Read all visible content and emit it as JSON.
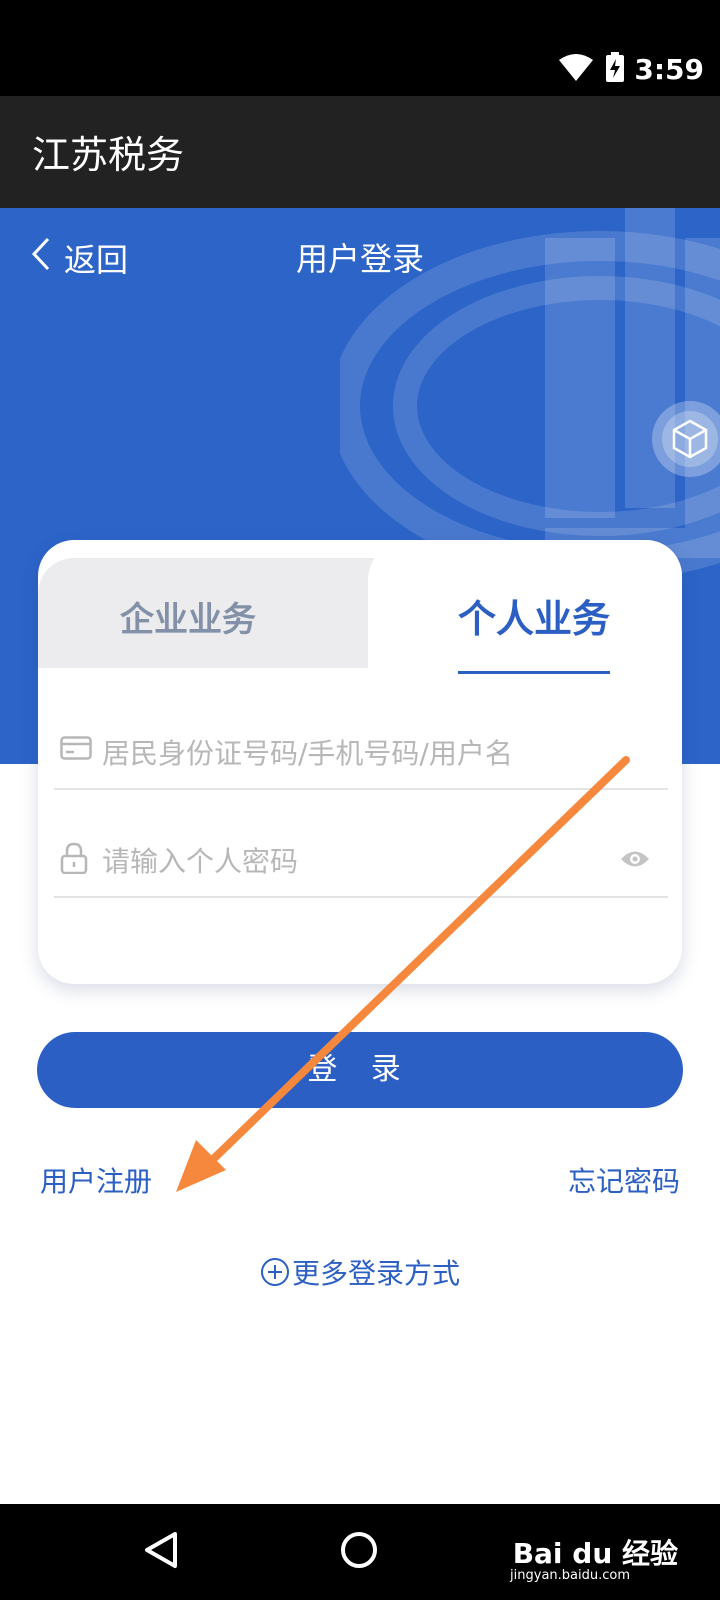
{
  "status_bar": {
    "time": "3:59"
  },
  "app_bar": {
    "title": "江苏税务"
  },
  "header": {
    "back_label": "返回",
    "title": "用户登录"
  },
  "tabs": [
    {
      "label": "企业业务",
      "active": false
    },
    {
      "label": "个人业务",
      "active": true
    }
  ],
  "form": {
    "id_placeholder": "居民身份证号码/手机号码/用户名",
    "password_placeholder": "请输入个人密码"
  },
  "login_button": "登 录",
  "links": {
    "register": "用户注册",
    "forgot": "忘记密码"
  },
  "more_login": "更多登录方式",
  "watermark": {
    "logo": "Bai du 经验",
    "url": "jingyan.baidu.com"
  },
  "colors": {
    "brand_blue": "#2c5fc3",
    "hero_blue": "#2c64c8",
    "annotation_orange": "#f5883c"
  }
}
